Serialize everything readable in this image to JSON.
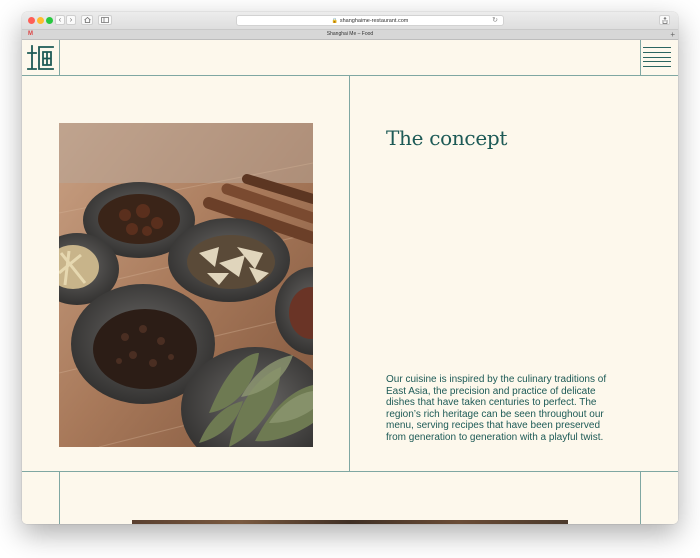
{
  "browser": {
    "url": "shanghaime-restaurant.com",
    "tab_title": "Shanghai Me – Food",
    "tab_favicon": "M",
    "add_tab": "+",
    "colors": {
      "close": "#fe5f57",
      "minimize": "#febc2e",
      "zoom": "#28c840"
    }
  },
  "page": {
    "logo_icon": "shanghai-me-logo-icon",
    "menu_icon": "hamburger-menu-icon",
    "photo_icon": "spices-photo",
    "concept": {
      "title": "The concept",
      "body": "Our cuisine is inspired by the culinary traditions of East Asia, the precision and practice of delicate dishes that have taken centuries to perfect. The region’s rich heritage can be seen throughout our menu, serving recipes that have been preserved from generation to generation with a playful twist."
    },
    "colors": {
      "background": "#fdf8ec",
      "accent": "#1d5a56",
      "rule": "#7fa7a2"
    }
  }
}
